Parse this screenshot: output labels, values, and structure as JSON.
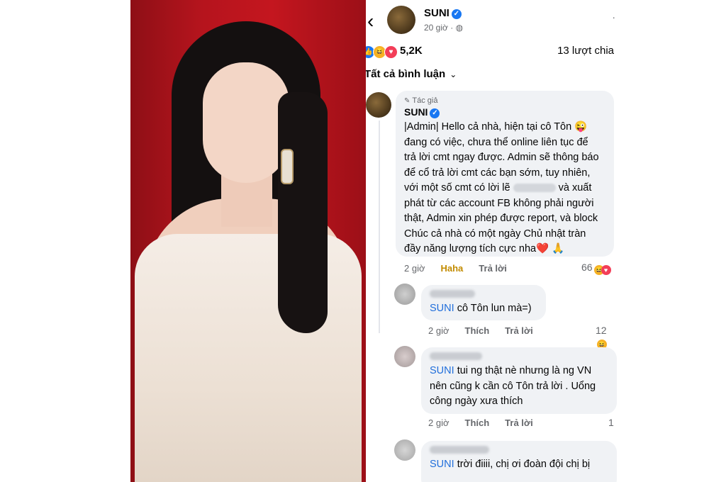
{
  "post": {
    "author": "SUNI",
    "time": "20 giờ",
    "reaction_count": "5,2K",
    "shares": "13 lượt chia",
    "filter_label": "Tất cả bình luận"
  },
  "comments": [
    {
      "author": "SUNI",
      "author_tag": "Tác giả",
      "text_lines": [
        "|Admin| Hello cả nhà, hiện tại cô Tôn 😜",
        "đang có việc, chưa thể online liên tục để",
        "trả lời cmt ngay được. Admin sẽ thông báo",
        "để cổ trả lời cmt các bạn sớm, tuy nhiên,",
        "với một số cmt có lời lẽ",
        "và xuất",
        "phát từ các account FB không phải người",
        "thật, Admin xin phép được report, và block",
        "Chúc cả nhà có một ngày Chủ nhật tràn",
        "đầy năng lượng tích cực nha❤️ 🙏"
      ],
      "time": "2 giờ",
      "action1": "Haha",
      "action2": "Trả lời",
      "react_count": "66"
    },
    {
      "mention": "SUNI",
      "text": "cô Tôn lun mà=)",
      "time": "2 giờ",
      "action1": "Thích",
      "action2": "Trả lời",
      "react_count": "12"
    },
    {
      "mention": "SUNI",
      "text_lines": [
        "tui ng thật nè nhưng là ng VN",
        "nên cũng k cần cô Tôn trả lời . Uổng",
        "công ngày xưa thích"
      ],
      "time": "2 giờ",
      "action1": "Thích",
      "action2": "Trả lời",
      "react_count": "1"
    },
    {
      "mention": "SUNI",
      "text": "trời điiii, chị ơi đoàn đội chị bị"
    }
  ],
  "icons": [
    "back-arrow-icon",
    "verified-icon",
    "globe-icon",
    "like-icon",
    "haha-icon",
    "love-icon",
    "chevron-down-icon",
    "pen-icon"
  ],
  "colors": {
    "link": "#216fdb",
    "bubble": "#f0f2f5",
    "verified": "#1877f2",
    "backdrop": "#c4161f"
  }
}
